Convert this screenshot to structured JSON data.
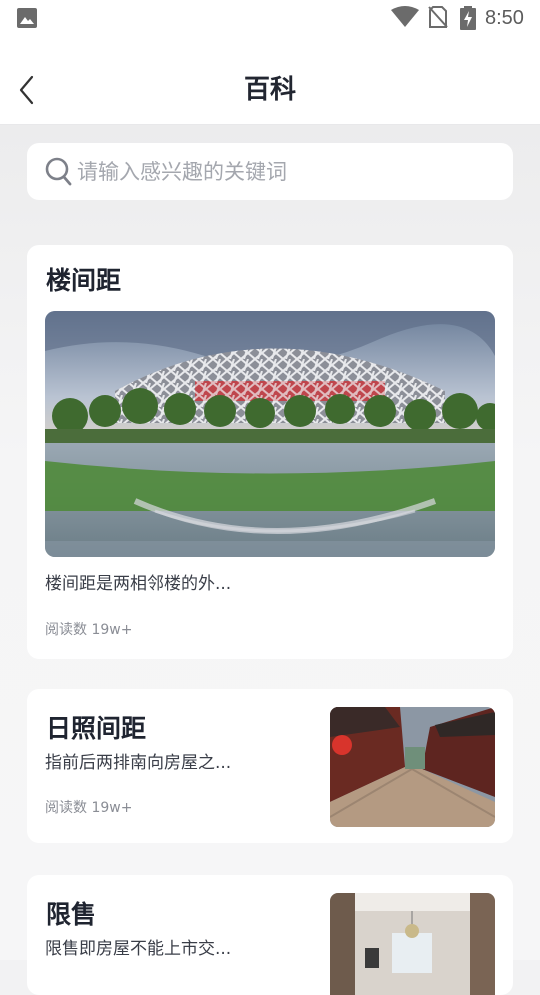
{
  "status_bar": {
    "time": "8:50",
    "icons": [
      "gallery-icon",
      "wifi-icon",
      "no-sim-icon",
      "battery-charging-icon"
    ]
  },
  "header": {
    "back_icon": "chevron-left-icon",
    "title": "百科"
  },
  "search": {
    "icon": "search-icon",
    "placeholder": "请输入感兴趣的关键词",
    "value": ""
  },
  "articles": [
    {
      "title": "楼间距",
      "description": "楼间距是两相邻楼的外...",
      "reads": "阅读数 19w+",
      "image": "bird-nest-stadium-photo"
    },
    {
      "title": "日照间距",
      "description": "指前后两排南向房屋之...",
      "reads": "阅读数 19w+",
      "image": "old-town-street-photo"
    },
    {
      "title": "限售",
      "description": "限售即房屋不能上市交...",
      "image": "interior-room-photo"
    }
  ],
  "colors": {
    "background": "#f2f2f3",
    "card": "#ffffff",
    "title_text": "#1f2430",
    "meta_text": "#8a8d95"
  }
}
